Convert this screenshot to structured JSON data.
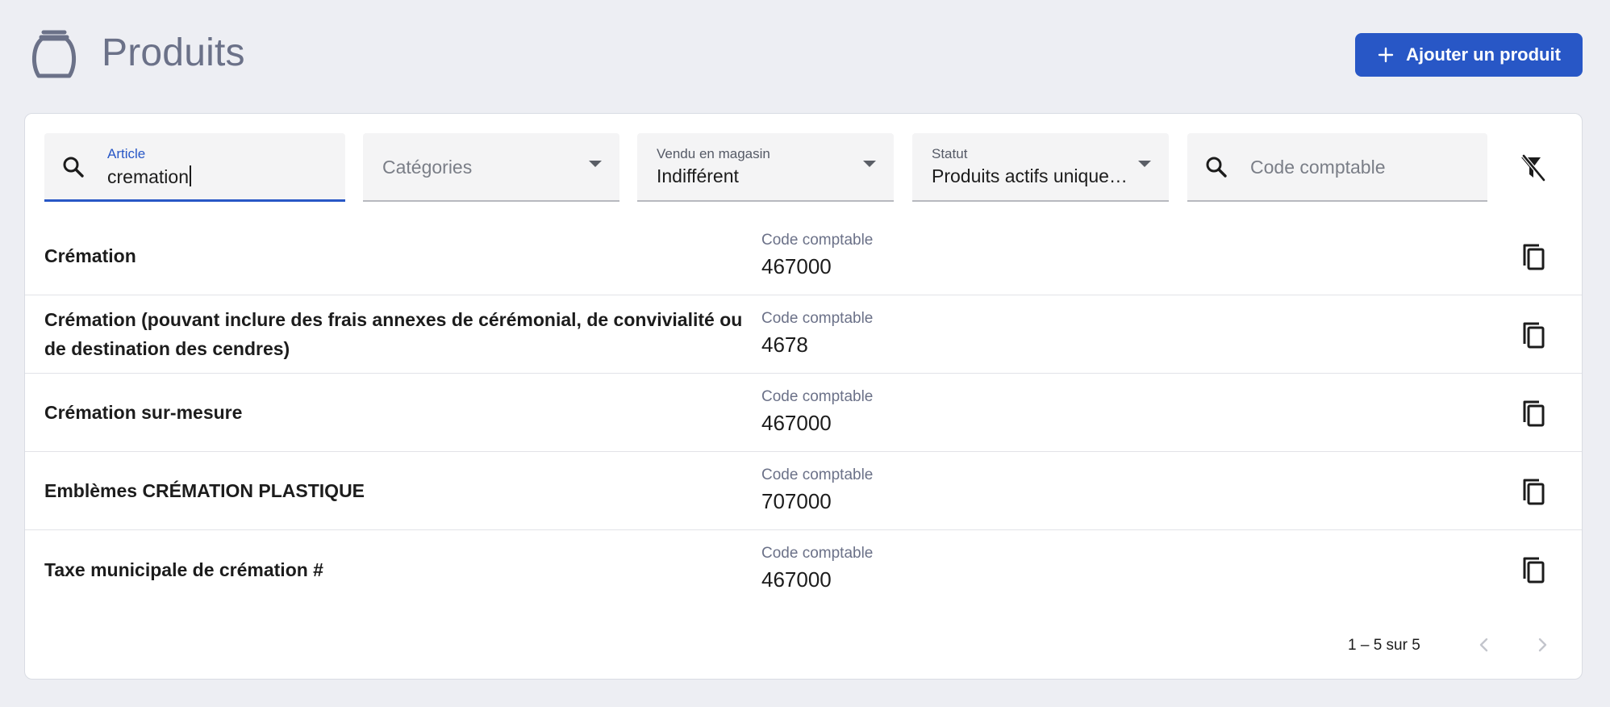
{
  "header": {
    "title": "Produits",
    "icon": "urn-icon",
    "add_button_label": "Ajouter un produit"
  },
  "colors": {
    "accent": "#2857c6",
    "background": "#edeef3",
    "title": "#6b7188"
  },
  "filters": {
    "article": {
      "label": "Article",
      "value": "cremation"
    },
    "categories": {
      "placeholder": "Catégories"
    },
    "vendu": {
      "label": "Vendu en magasin",
      "value": "Indifférent"
    },
    "statut": {
      "label": "Statut",
      "value": "Produits actifs unique…"
    },
    "code": {
      "placeholder": "Code comptable"
    }
  },
  "columns": {
    "code_label": "Code comptable"
  },
  "rows": [
    {
      "name": "Crémation",
      "code_label": "Code comptable",
      "code": "467000"
    },
    {
      "name": "Crémation (pouvant inclure des frais annexes de cérémonial, de convivialité ou de destination des cendres)",
      "code_label": "Code comptable",
      "code": "4678"
    },
    {
      "name": "Crémation sur-mesure",
      "code_label": "Code comptable",
      "code": "467000"
    },
    {
      "name": "Emblèmes CRÉMATION PLASTIQUE",
      "code_label": "Code comptable",
      "code": "707000"
    },
    {
      "name": "Taxe municipale de crémation #",
      "code_label": "Code comptable",
      "code": "467000"
    }
  ],
  "pagination": {
    "range": "1 – 5 sur 5"
  }
}
